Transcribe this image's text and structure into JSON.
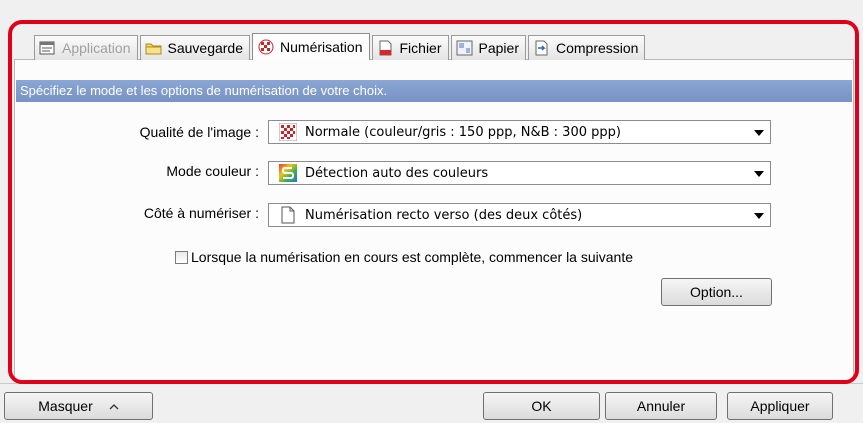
{
  "tabs": [
    {
      "label": "Application",
      "icon": "application-icon",
      "state": "disabled"
    },
    {
      "label": "Sauvegarde",
      "icon": "folder-icon",
      "state": "normal"
    },
    {
      "label": "Numérisation",
      "icon": "scan-quality-icon",
      "state": "active"
    },
    {
      "label": "Fichier",
      "icon": "file-icon",
      "state": "normal"
    },
    {
      "label": "Papier",
      "icon": "paper-icon",
      "state": "normal"
    },
    {
      "label": "Compression",
      "icon": "compression-icon",
      "state": "normal"
    }
  ],
  "banner": "Spécifiez le mode et les options de numérisation de votre choix.",
  "fields": {
    "quality": {
      "label": "Qualité de l'image :",
      "value": "Normale (couleur/gris : 150 ppp, N&B : 300 ppp)",
      "icon": "quality-checker-icon"
    },
    "color_mode": {
      "label": "Mode couleur :",
      "value": "Détection auto des couleurs",
      "icon": "color-mode-icon"
    },
    "side": {
      "label": "Côté à numériser :",
      "value": "Numérisation recto verso (des deux côtés)",
      "icon": "page-icon"
    }
  },
  "checkbox": {
    "label": "Lorsque la numérisation en cours est complète, commencer la suivante",
    "checked": false
  },
  "buttons": {
    "option": "Option...",
    "hide": "Masquer",
    "ok": "OK",
    "cancel": "Annuler",
    "apply": "Appliquer"
  },
  "colors": {
    "highlight": "#e0001a",
    "banner": "#7f9acb"
  }
}
